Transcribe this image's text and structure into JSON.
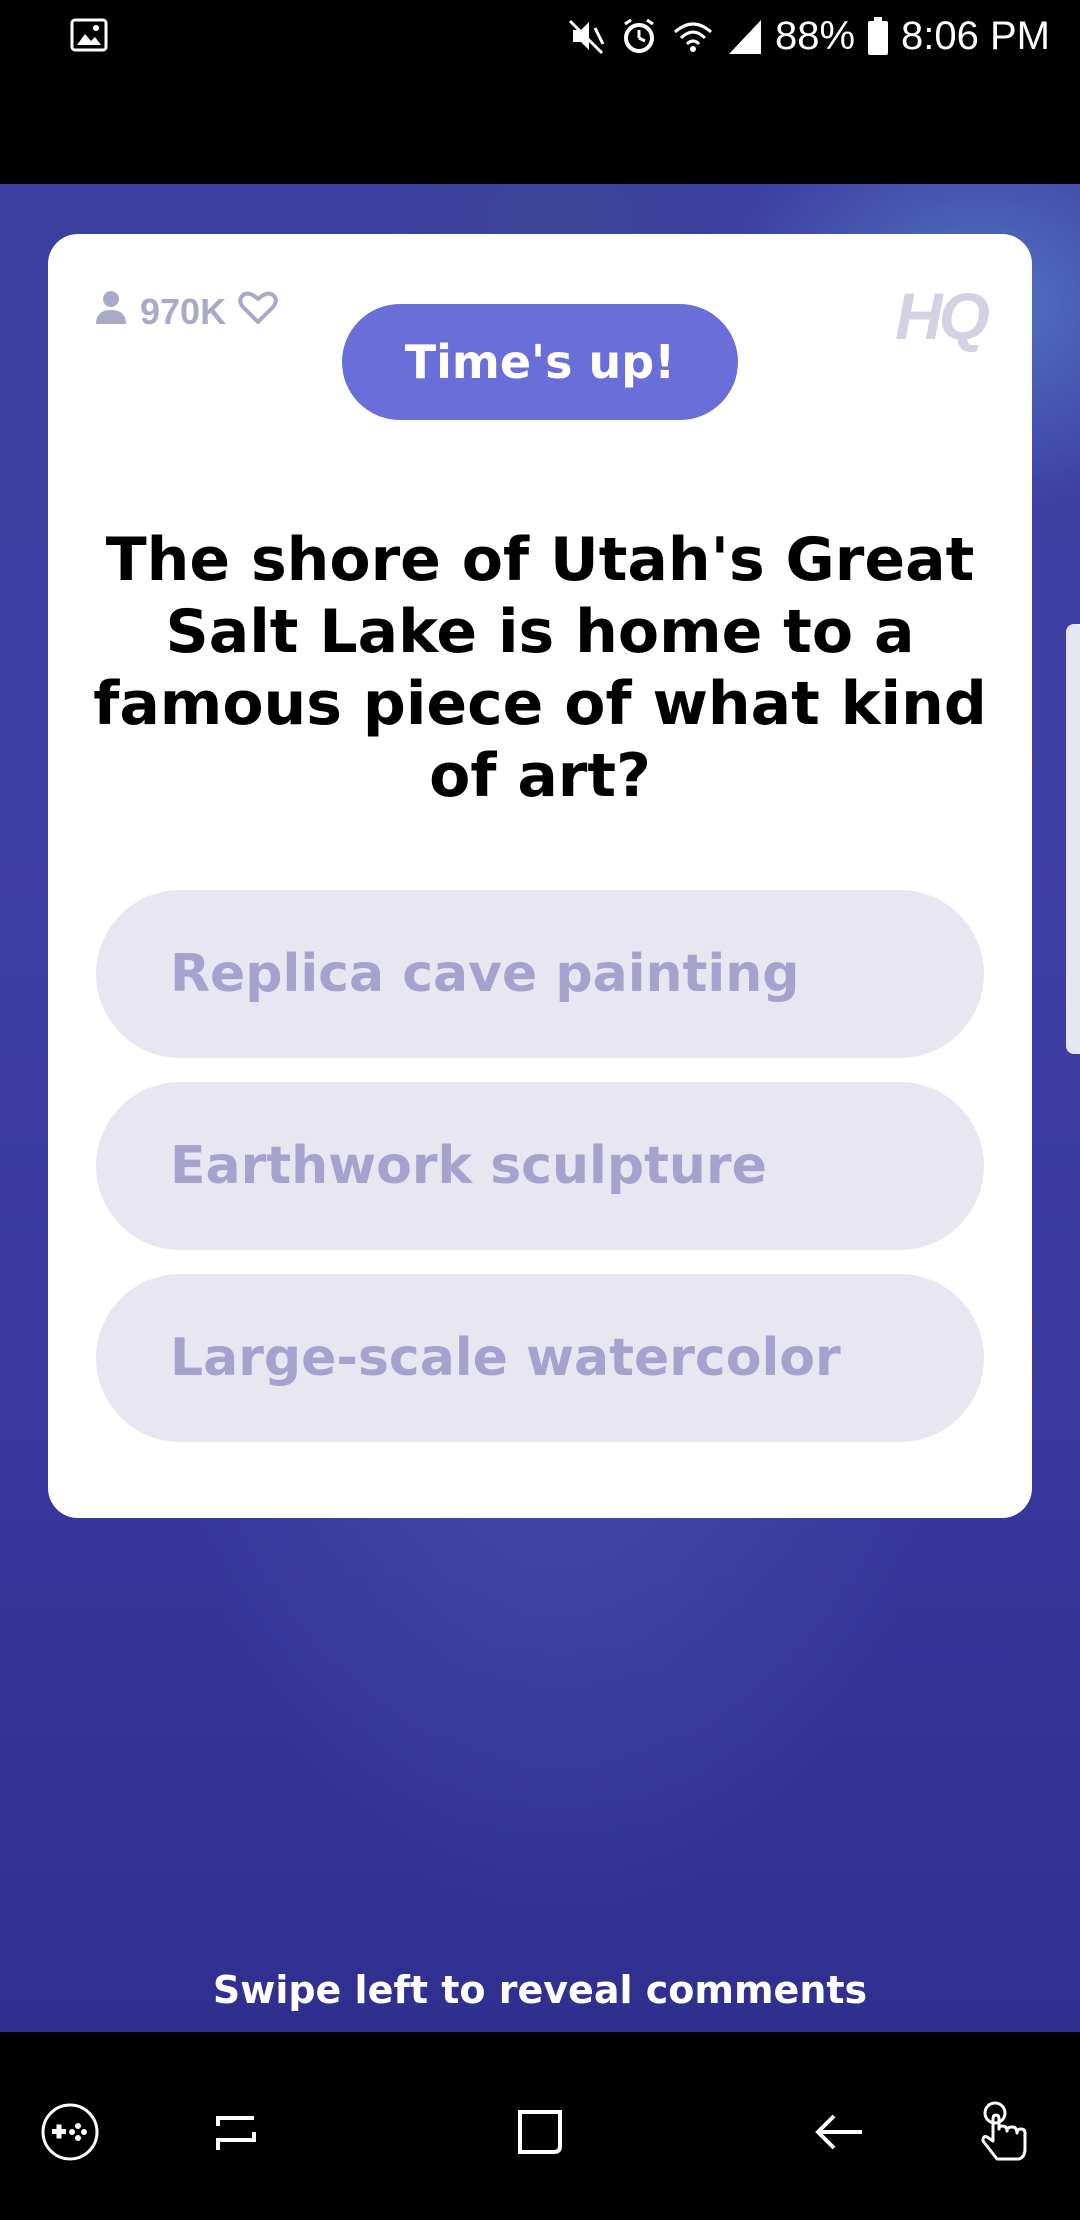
{
  "status_bar": {
    "battery": "88%",
    "time": "8:06 PM",
    "left_icon": "image-icon",
    "icons": [
      "mute-icon",
      "alarm-icon",
      "wifi-icon",
      "signal-icon",
      "battery-icon"
    ]
  },
  "game": {
    "viewer_count": "970K",
    "logo": "HQ",
    "timer_label": "Time's up!",
    "question": "The shore of Utah's Great Salt Lake is home to a famous piece of what kind of art?",
    "answers": [
      {
        "label": "Replica cave painting"
      },
      {
        "label": "Earthwork sculpture"
      },
      {
        "label": "Large-scale watercolor"
      }
    ],
    "swipe_hint": "Swipe left to reveal comments"
  },
  "nav_bar": {
    "buttons": [
      "game-launcher-icon",
      "recent-apps-icon",
      "home-icon",
      "back-icon",
      "assistant-icon"
    ]
  },
  "colors": {
    "accent": "#6a6ed8",
    "answer_bg": "#e7e6f1",
    "answer_text": "#a5a3ce",
    "background": "#3c3f9e"
  }
}
